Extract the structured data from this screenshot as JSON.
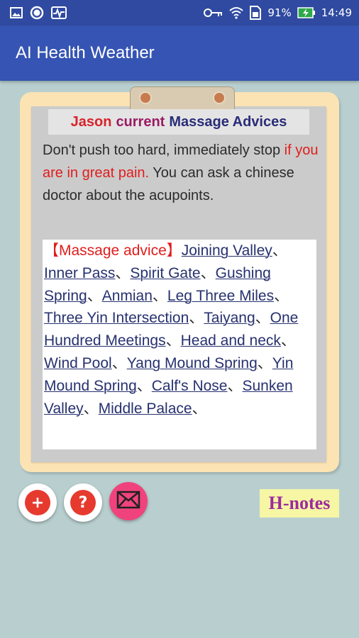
{
  "statusbar": {
    "battery_percent": "91%",
    "time": "14:49",
    "icons": [
      "image-icon",
      "circle-icon",
      "pulse-icon",
      "key-icon",
      "wifi-icon",
      "sim-icon",
      "battery-charging-icon"
    ]
  },
  "appbar": {
    "title": "AI Health Weather"
  },
  "card": {
    "title_name": "Jason",
    "title_mid": "current",
    "title_rest": "Massage Advices",
    "desc_part1": "Don't push too hard, immediately stop ",
    "desc_red": "if you are in great pain.",
    "desc_part2": " You can ask a chinese doctor about the acupoints.",
    "advice_head": "【Massage advice】",
    "separator": "、",
    "points": [
      "Joining Valley",
      "Inner Pass",
      "Spirit Gate",
      "Gushing Spring",
      "Anmian",
      "Leg Three Miles",
      "Three Yin Intersection",
      "Taiyang",
      "One Hundred Meetings",
      "Head and neck",
      "Wind Pool",
      "Yang Mound Spring",
      "Yin Mound Spring",
      "Calf's Nose",
      "Sunken Valley",
      "Middle Palace"
    ]
  },
  "buttons": {
    "add": "+",
    "help": "?",
    "mail": "✉"
  },
  "hnotes": {
    "label": "H-notes"
  },
  "colors": {
    "statusbar": "#2f4aa0",
    "appbar": "#3554b3",
    "background": "#b9cfcf",
    "board": "#fbe3b3",
    "accent_red": "#e11d1d",
    "link": "#27316f",
    "mail_fab": "#f0437d"
  }
}
